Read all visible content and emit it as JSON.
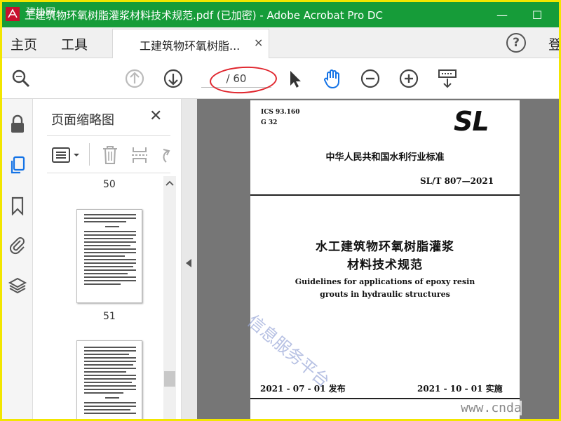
{
  "window": {
    "title": "工建筑物环氧树脂灌浆材料技术规范.pdf  (已加密)  - Adobe Acrobat Pro DC",
    "min": "—",
    "max": "☐",
    "watermark_tl": "建协网"
  },
  "menu": {
    "home": "主页",
    "tools": "工具",
    "doc_tab": "工建筑物环氧树脂...",
    "doc_tab_close": "×",
    "help": "?",
    "signin": "登"
  },
  "toolbar": {
    "page_current": "",
    "page_total": "/ 60"
  },
  "thumbnails": {
    "title": "页面缩略图",
    "close": "✕",
    "pages": [
      "50",
      "51"
    ]
  },
  "document": {
    "ics": "ICS 93.160",
    "g": "G 32",
    "logo": "SL",
    "org": "中华人民共和国水利行业标准",
    "std_no": "SL/T 807—2021",
    "title_cn_1": "水工建筑物环氧树脂灌浆",
    "title_cn_2": "材料技术规范",
    "title_en_1": "Guidelines for applications of epoxy resin",
    "title_en_2": "grouts in hydraulic structures",
    "issue_date": "2021 - 07 - 01 发布",
    "impl_date": "2021 - 10 - 01 实施",
    "watermark_cn": "信息服务平台",
    "watermark_url": "www.cnda"
  },
  "colors": {
    "titlebar": "#169c39",
    "frame": "#f2e600",
    "accent_blue": "#1473e6",
    "annotation_red": "#e0262e"
  }
}
